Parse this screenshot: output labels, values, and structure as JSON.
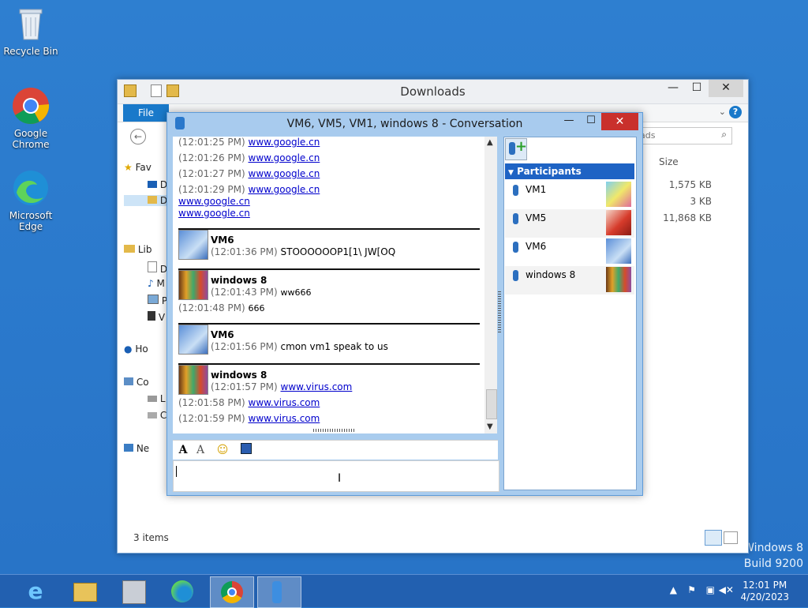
{
  "desktop": {
    "icons": [
      {
        "label": "Recycle Bin",
        "icon": "recycle-bin-icon"
      },
      {
        "label": "Google Chrome",
        "icon": "chrome-icon"
      },
      {
        "label": "Microsoft Edge",
        "icon": "edge-icon"
      }
    ],
    "watermark_line1": "Windows 8",
    "watermark_line2": "Build 9200"
  },
  "explorer": {
    "title": "Downloads",
    "minimize": "—",
    "maximize": "☐",
    "close": "✕",
    "file_tab": "File",
    "search_placeholder": "ads",
    "column_size": "Size",
    "sizes": [
      "1,575 KB",
      "3 KB",
      "11,868 KB"
    ],
    "nav_items": [
      {
        "label": "Fav",
        "icon": "star-icon"
      },
      {
        "label": "D",
        "icon": "desktop-icon"
      },
      {
        "label": "D",
        "icon": "downloads-folder-icon"
      },
      {
        "label": "Lib",
        "icon": "libraries-icon"
      },
      {
        "label": "D",
        "icon": "documents-icon"
      },
      {
        "label": "M",
        "icon": "music-icon"
      },
      {
        "label": "P",
        "icon": "pictures-icon"
      },
      {
        "label": "V",
        "icon": "videos-icon"
      },
      {
        "label": "Ho",
        "icon": "homegroup-icon"
      },
      {
        "label": "Co",
        "icon": "computer-icon"
      },
      {
        "label": "L",
        "icon": "local-disk-icon"
      },
      {
        "label": "C",
        "icon": "cd-drive-icon"
      },
      {
        "label": "Ne",
        "icon": "network-icon"
      }
    ],
    "status": "3 items"
  },
  "conversation": {
    "title": "VM6, VM5, VM1, windows 8 - Conversation",
    "minimize": "—",
    "maximize": "☐",
    "close": "✕",
    "messages": [
      {
        "time": "(12:01:25 PM)",
        "text": "www.google.cn",
        "link": true
      },
      {
        "time": "(12:01:26 PM)",
        "text": "www.google.cn",
        "link": true
      },
      {
        "time": "(12:01:27 PM)",
        "text": "www.google.cn",
        "link": true
      },
      {
        "time": "(12:01:29 PM)",
        "text": "www.google.cn",
        "link": true
      },
      {
        "time": "",
        "text": "www.google.cn",
        "link": true
      },
      {
        "time": "",
        "text": "www.google.cn",
        "link": true
      }
    ],
    "blocks": [
      {
        "sender": "VM6",
        "avatar": "vm6",
        "lines": [
          {
            "time": "(12:01:36 PM)",
            "text": "STOOOOOOP1[1\\ JW[OQ",
            "link": false
          }
        ]
      },
      {
        "sender": "windows 8",
        "avatar": "w8",
        "lines": [
          {
            "time": "(12:01:43 PM)",
            "text": "ww666",
            "link": false
          },
          {
            "time": "(12:01:48 PM)",
            "text": "666",
            "link": false
          }
        ]
      },
      {
        "sender": "VM6",
        "avatar": "vm6",
        "lines": [
          {
            "time": "(12:01:56 PM)",
            "text": "cmon vm1 speak to us",
            "link": false
          }
        ]
      },
      {
        "sender": "windows 8",
        "avatar": "w8",
        "lines": [
          {
            "time": "(12:01:57 PM)",
            "text": "www.virus.com",
            "link": true
          },
          {
            "time": "(12:01:58 PM)",
            "text": "www.virus.com",
            "link": true
          },
          {
            "time": "(12:01:59 PM)",
            "text": "www.virus.com",
            "link": true
          }
        ]
      }
    ],
    "input_value": "",
    "participants_header": "Participants",
    "participants": [
      {
        "name": "VM1",
        "avatar": "vm1"
      },
      {
        "name": "VM5",
        "avatar": "vm5"
      },
      {
        "name": "VM6",
        "avatar": "vm6"
      },
      {
        "name": "windows 8",
        "avatar": "w8"
      }
    ]
  },
  "taskbar": {
    "apps": [
      "internet-explorer-icon",
      "file-explorer-icon",
      "messenger-setup-icon",
      "edge-icon",
      "chrome-icon",
      "messenger-icon"
    ],
    "time": "12:01 PM",
    "date": "4/20/2023"
  },
  "colors": {
    "accent": "#1979ca",
    "taskbar": "#2260b0",
    "close_red": "#c9302c",
    "link": "#0000cc"
  }
}
